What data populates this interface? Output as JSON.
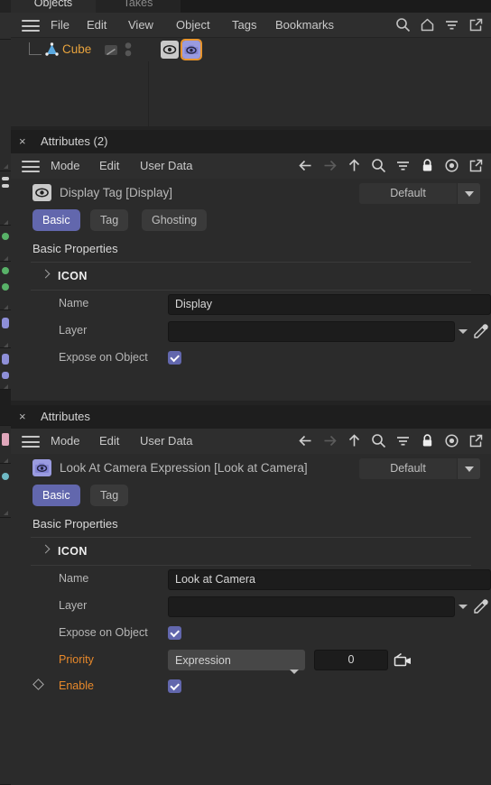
{
  "window": {
    "tabs": [
      {
        "label": "Objects",
        "active": true
      },
      {
        "label": "Takes",
        "active": false
      }
    ]
  },
  "objects_panel": {
    "menus": [
      "File",
      "Edit",
      "View",
      "Object",
      "Tags",
      "Bookmarks"
    ],
    "toolbar_icons": [
      "search-icon",
      "home-icon",
      "filter-icon",
      "open-external-icon"
    ],
    "hamburger": "menu-icon",
    "row": {
      "name": "Cube",
      "name_color": "#e8a33d",
      "object_icon": "cone-object-icon",
      "tags": [
        {
          "name": "display-tag",
          "color": "#c9c9c9",
          "selected": false
        },
        {
          "name": "look-at-camera-tag",
          "color": "#9a9be0",
          "selected": true
        }
      ]
    }
  },
  "attributes_panels": [
    {
      "title": "Attributes (2)",
      "close_label": "×",
      "menus": [
        "Mode",
        "Edit",
        "User Data"
      ],
      "toolbar_icons": [
        "back-arrow-icon",
        "forward-arrow-icon",
        "up-arrow-icon",
        "search-icon",
        "filter-icon",
        "lock-icon",
        "record-target-icon",
        "open-external-icon"
      ],
      "header_label": "Display Tag [Display]",
      "header_icon": "eye-icon",
      "header_icon_color": "#c9c9c9",
      "preset": "Default",
      "tabs": [
        {
          "label": "Basic",
          "active": true
        },
        {
          "label": "Tag",
          "active": false
        },
        {
          "label": "Ghosting",
          "active": false
        }
      ],
      "section_title": "Basic Properties",
      "icon_group_label": "ICON",
      "properties": [
        {
          "label": "Name",
          "type": "text",
          "value": "Display",
          "animated": false
        },
        {
          "label": "Layer",
          "type": "layer",
          "value": "",
          "animated": false
        },
        {
          "label": "Expose on Object",
          "type": "check",
          "value": true,
          "animated": false
        }
      ]
    },
    {
      "title": "Attributes",
      "close_label": "×",
      "menus": [
        "Mode",
        "Edit",
        "User Data"
      ],
      "toolbar_icons": [
        "back-arrow-icon",
        "forward-arrow-icon",
        "up-arrow-icon",
        "search-icon",
        "filter-icon",
        "lock-icon",
        "record-target-icon",
        "open-external-icon"
      ],
      "header_label": "Look At Camera Expression [Look at Camera]",
      "header_icon": "camera-eye-icon",
      "header_icon_color": "#9a9be0",
      "preset": "Default",
      "tabs": [
        {
          "label": "Basic",
          "active": true
        },
        {
          "label": "Tag",
          "active": false
        }
      ],
      "section_title": "Basic Properties",
      "icon_group_label": "ICON",
      "properties": [
        {
          "label": "Name",
          "type": "text",
          "value": "Look at Camera",
          "animated": false
        },
        {
          "label": "Layer",
          "type": "layer",
          "value": "",
          "animated": false
        },
        {
          "label": "Expose on Object",
          "type": "check",
          "value": true,
          "animated": false
        },
        {
          "label": "Priority",
          "type": "priority",
          "select_value": "Expression",
          "number_value": "0",
          "animated": true
        },
        {
          "label": "Enable",
          "type": "check",
          "value": true,
          "animated": true,
          "keyframe": true
        }
      ]
    }
  ],
  "colors": {
    "accent_purple": "#6267ad",
    "accent_orange": "#e8892b",
    "panel_bg": "#2b2b2b",
    "title_bg": "#1e1e1e",
    "field_bg": "#1c1c1c"
  }
}
